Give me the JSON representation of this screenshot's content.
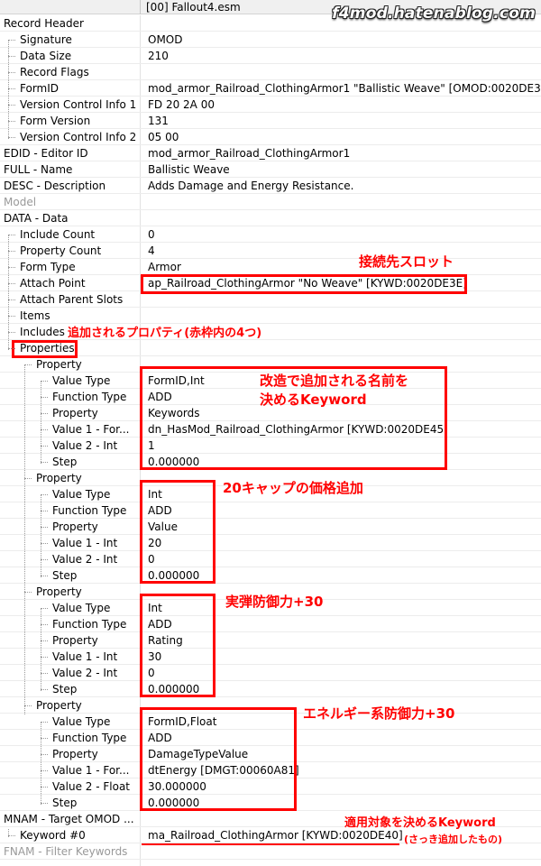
{
  "header": {
    "file": "[00] Fallout4.esm"
  },
  "watermark": "f4mod.hatenablog.com",
  "rows": [
    {
      "name": "Record Header",
      "value": ""
    },
    {
      "name": "Signature",
      "value": "OMOD"
    },
    {
      "name": "Data Size",
      "value": "210"
    },
    {
      "name": "Record Flags",
      "value": ""
    },
    {
      "name": "FormID",
      "value": "mod_armor_Railroad_ClothingArmor1 \"Ballistic Weave\" [OMOD:0020DE3F]"
    },
    {
      "name": "Version Control Info 1",
      "value": "FD 20 2A 00"
    },
    {
      "name": "Form Version",
      "value": "131"
    },
    {
      "name": "Version Control Info 2",
      "value": "05 00"
    },
    {
      "name": "EDID - Editor ID",
      "value": "mod_armor_Railroad_ClothingArmor1"
    },
    {
      "name": "FULL - Name",
      "value": "Ballistic Weave"
    },
    {
      "name": "DESC - Description",
      "value": "Adds Damage and Energy Resistance."
    },
    {
      "name": "Model",
      "value": ""
    },
    {
      "name": "DATA - Data",
      "value": ""
    },
    {
      "name": "Include Count",
      "value": "0"
    },
    {
      "name": "Property Count",
      "value": "4"
    },
    {
      "name": "Form Type",
      "value": "Armor"
    },
    {
      "name": "Attach Point",
      "value": "ap_Railroad_ClothingArmor \"No Weave\" [KYWD:0020DE3E]"
    },
    {
      "name": "Attach Parent Slots",
      "value": ""
    },
    {
      "name": "Items",
      "value": ""
    },
    {
      "name": "Includes",
      "value": ""
    },
    {
      "name": "Properties",
      "value": ""
    },
    {
      "name": "Property",
      "value": ""
    },
    {
      "name": "Value Type",
      "value": "FormID,Int"
    },
    {
      "name": "Function Type",
      "value": "ADD"
    },
    {
      "name": "Property",
      "value": "Keywords"
    },
    {
      "name": "Value 1 - For...",
      "value": "dn_HasMod_Railroad_ClothingArmor [KYWD:0020DE45]"
    },
    {
      "name": "Value 2 - Int",
      "value": "1"
    },
    {
      "name": "Step",
      "value": "0.000000"
    },
    {
      "name": "Property",
      "value": ""
    },
    {
      "name": "Value Type",
      "value": "Int"
    },
    {
      "name": "Function Type",
      "value": "ADD"
    },
    {
      "name": "Property",
      "value": "Value"
    },
    {
      "name": "Value 1 - Int",
      "value": "20"
    },
    {
      "name": "Value 2 - Int",
      "value": "0"
    },
    {
      "name": "Step",
      "value": "0.000000"
    },
    {
      "name": "Property",
      "value": ""
    },
    {
      "name": "Value Type",
      "value": "Int"
    },
    {
      "name": "Function Type",
      "value": "ADD"
    },
    {
      "name": "Property",
      "value": "Rating"
    },
    {
      "name": "Value 1 - Int",
      "value": "30"
    },
    {
      "name": "Value 2 - Int",
      "value": "0"
    },
    {
      "name": "Step",
      "value": "0.000000"
    },
    {
      "name": "Property",
      "value": ""
    },
    {
      "name": "Value Type",
      "value": "FormID,Float"
    },
    {
      "name": "Function Type",
      "value": "ADD"
    },
    {
      "name": "Property",
      "value": "DamageTypeValue"
    },
    {
      "name": "Value 1 - For...",
      "value": "dtEnergy [DMGT:00060A81]"
    },
    {
      "name": "Value 2 - Float",
      "value": "30.000000"
    },
    {
      "name": "Step",
      "value": "0.000000"
    },
    {
      "name": "MNAM - Target OMOD ...",
      "value": ""
    },
    {
      "name": "Keyword #0",
      "value": "ma_Railroad_ClothingArmor [KYWD:0020DE40]"
    },
    {
      "name": "FNAM - Filter Keywords",
      "value": ""
    }
  ],
  "annotations": {
    "attach": "接続先スロット",
    "properties": "追加されるプロパティ(赤枠内の4つ)",
    "keyword_name_1": "改造で追加される名前を",
    "keyword_name_2": "決めるKeyword",
    "price": "20キャップの価格追加",
    "ballistic": "実弾防御力+30",
    "energy": "エネルギー系防御力+30",
    "target_1": "適用対象を決めるKeyword",
    "target_2": "(さっき追加したもの)"
  },
  "colors": {
    "annotation": "#ff0000"
  }
}
